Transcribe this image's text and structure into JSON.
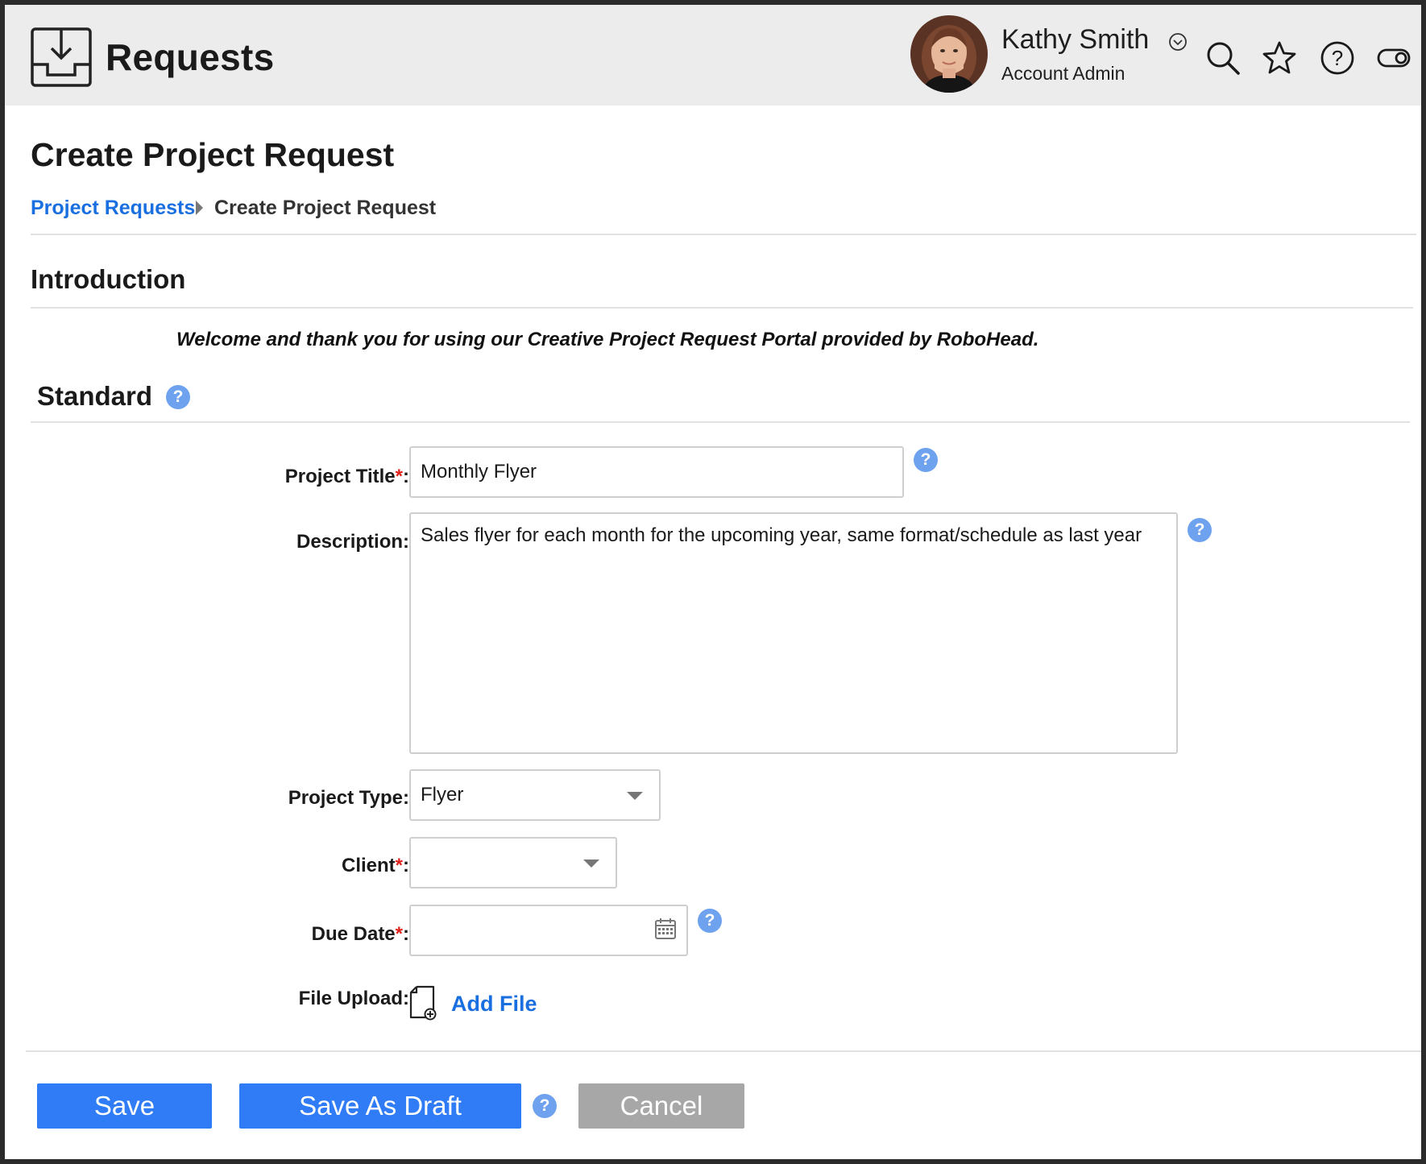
{
  "header": {
    "app_title": "Requests",
    "user_name": "Kathy Smith",
    "user_role": "Account Admin"
  },
  "page": {
    "title": "Create Project Request",
    "breadcrumb": {
      "parent": "Project Requests",
      "current": "Create Project Request"
    }
  },
  "intro": {
    "heading": "Introduction",
    "text": "Welcome and thank you for using our Creative Project Request Portal provided by RoboHead."
  },
  "standard": {
    "heading": "Standard",
    "help": "?"
  },
  "form": {
    "project_title": {
      "label": "Project Title",
      "required_mark": "*",
      "colon": ":",
      "value": "Monthly Flyer"
    },
    "description": {
      "label": "Description:",
      "value": "Sales flyer for each month for the upcoming year, same format/schedule as last year"
    },
    "project_type": {
      "label": "Project Type:",
      "value": "Flyer"
    },
    "client": {
      "label": "Client",
      "required_mark": "*",
      "colon": ":",
      "value": ""
    },
    "due_date": {
      "label": "Due Date",
      "required_mark": "*",
      "colon": ":",
      "value": ""
    },
    "file_upload": {
      "label": "File Upload:",
      "link": "Add File"
    }
  },
  "buttons": {
    "save": "Save",
    "save_draft": "Save As Draft",
    "cancel": "Cancel"
  },
  "colors": {
    "accent": "#2f7cf6",
    "link": "#1a6fe0",
    "help": "#6ea2ee",
    "required": "#e0201b",
    "cancel": "#a7a7a7"
  },
  "icons": [
    "inbox-download-icon",
    "chevron-down-circle-icon",
    "search-icon",
    "star-icon",
    "help-circle-icon",
    "toggle-icon",
    "help-icon",
    "calendar-icon",
    "add-file-icon",
    "dropdown-caret-icon"
  ]
}
